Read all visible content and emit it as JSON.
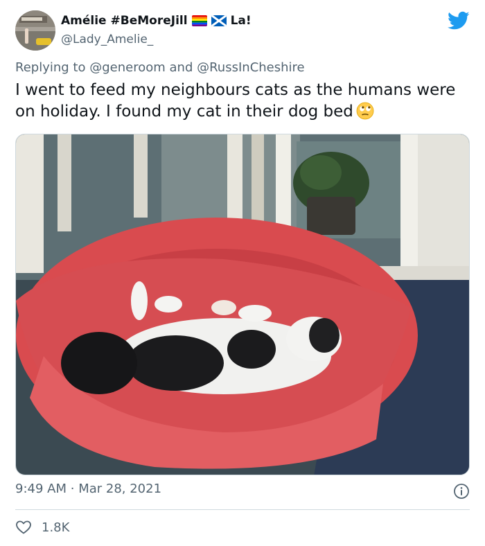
{
  "author": {
    "display_name": "Amélie #BeMoreJill",
    "suffix": "La!",
    "handle": "@Lady_Amelie_",
    "flag_icons": [
      "rainbow-flag-icon",
      "scotland-flag-icon"
    ]
  },
  "reply": {
    "prefix": "Replying to",
    "mention1": "@generoom",
    "conjunction": "and",
    "mention2": "@RussInCheshire"
  },
  "tweet": {
    "text": "I went to feed my neighbours cats as the humans were on holiday. I found my cat in their dog bed",
    "emoji": "face-with-rolling-eyes-icon",
    "image": "cat-in-red-dog-bed-photo"
  },
  "meta": {
    "time": "9:49 AM",
    "separator": "·",
    "date": "Mar 28, 2021"
  },
  "engagement": {
    "likes": "1.8K"
  },
  "colors": {
    "twitter_blue": "#1d9bf0",
    "secondary_text": "#536471",
    "divider": "#cfd9de"
  }
}
